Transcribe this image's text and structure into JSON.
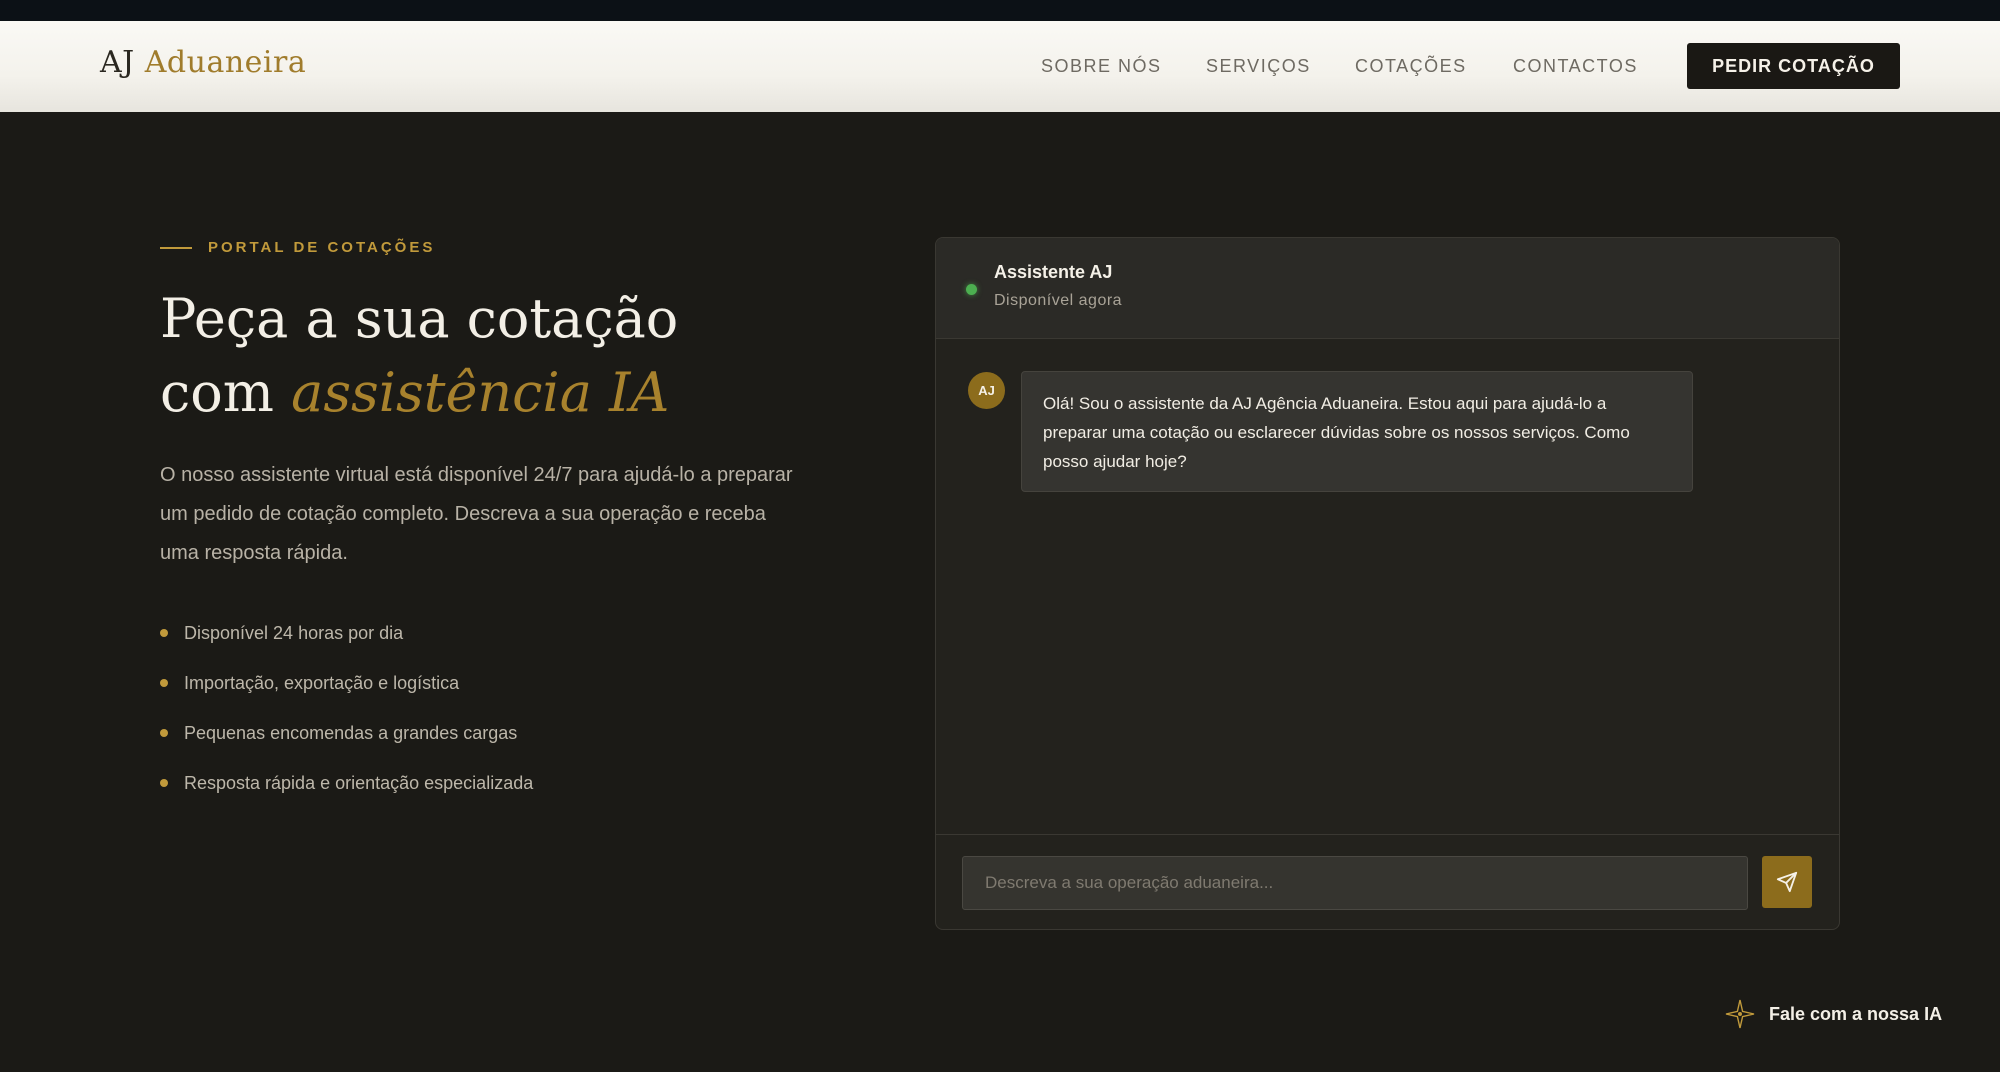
{
  "header": {
    "logo_prefix": "AJ",
    "logo_accent": "Aduaneira",
    "nav": [
      "SOBRE NÓS",
      "SERVIÇOS",
      "COTAÇÕES",
      "CONTACTOS"
    ],
    "cta_label": "PEDIR COTAÇÃO"
  },
  "hero": {
    "eyebrow": "PORTAL DE COTAÇÕES",
    "headline_line1": "Peça a sua cotação",
    "headline_line2_prefix": "com",
    "headline_line2_italic": "assistência IA",
    "lead": "O nosso assistente virtual está disponível 24/7 para ajudá-lo a preparar um pedido de cotação completo. Descreva a sua operação e receba uma resposta rápida.",
    "features": [
      "Disponível 24 horas por dia",
      "Importação, exportação e logística",
      "Pequenas encomendas a grandes cargas",
      "Resposta rápida e orientação especializada"
    ]
  },
  "chat": {
    "bot_name": "Assistente AJ",
    "bot_status": "Disponível agora",
    "avatar_initials": "AJ",
    "message": "Olá! Sou o assistente da AJ Agência Aduaneira. Estou aqui para ajudá-lo a preparar uma cotação ou esclarecer dúvidas sobre os nossos serviços. Como posso ajudar hoje?",
    "input_placeholder": "Descreva a sua operação aduaneira...",
    "input_value": ""
  },
  "fab": {
    "label": "Fale com a nossa IA"
  },
  "colors": {
    "accent": "#c19a3b",
    "accent_dark": "#8c6c1c",
    "background": "#1b1a16",
    "status_online": "#4caf50"
  },
  "icons": {
    "send": "send-icon",
    "sparkle": "sparkle-icon",
    "status": "online-dot"
  }
}
